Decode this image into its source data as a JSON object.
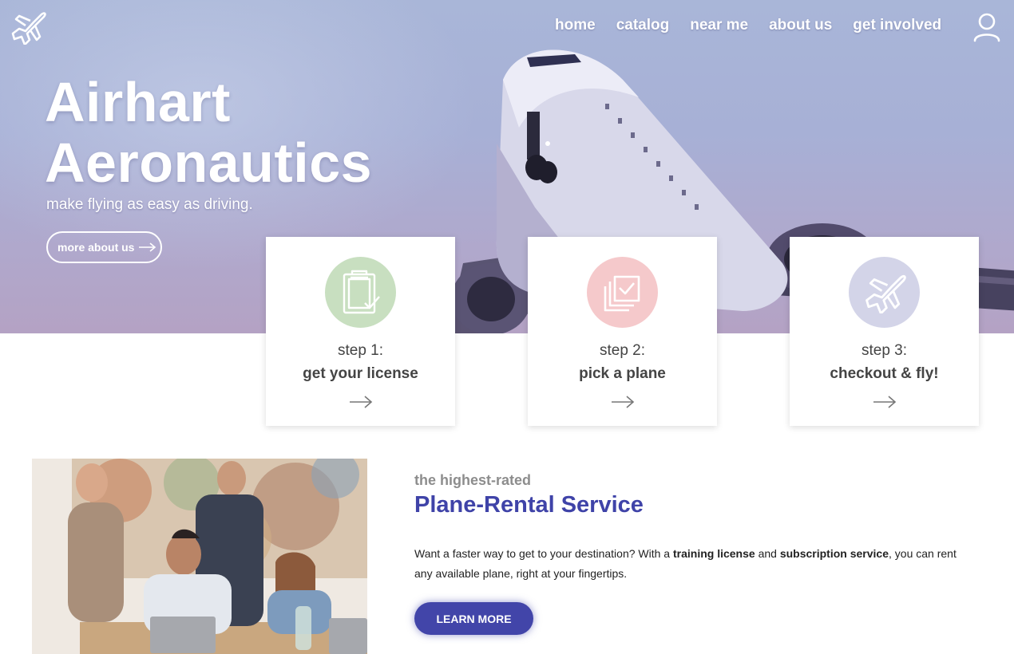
{
  "nav": {
    "items": [
      {
        "label": "home"
      },
      {
        "label": "catalog"
      },
      {
        "label": "near me"
      },
      {
        "label": "about us"
      },
      {
        "label": "get involved"
      }
    ]
  },
  "hero": {
    "title_line1": "Airhart",
    "title_line2": "Aeronautics",
    "subtitle": "make flying as easy as driving.",
    "button_label": "more about us"
  },
  "steps": [
    {
      "number": "step 1:",
      "text": "get your license",
      "icon": "clipboard-check-icon",
      "color": "#c8dfc0"
    },
    {
      "number": "step 2:",
      "text": "pick a plane",
      "icon": "gallery-check-icon",
      "color": "#f5c9cb"
    },
    {
      "number": "step 3:",
      "text": "checkout & fly!",
      "icon": "airplane-icon",
      "color": "#d3d4e8"
    }
  ],
  "feature": {
    "eyebrow": "the highest-rated",
    "headline": "Plane-Rental Service",
    "body_pre": "Want a faster way to get to your destination? With a ",
    "body_bold1": "training license",
    "body_mid": " and ",
    "body_bold2": "subscription service",
    "body_post": ", you can rent any available plane, right at your fingertips.",
    "button_label": "LEARN MORE"
  },
  "colors": {
    "accent": "#4245a9",
    "hero_tint": "#a9b6d8"
  }
}
